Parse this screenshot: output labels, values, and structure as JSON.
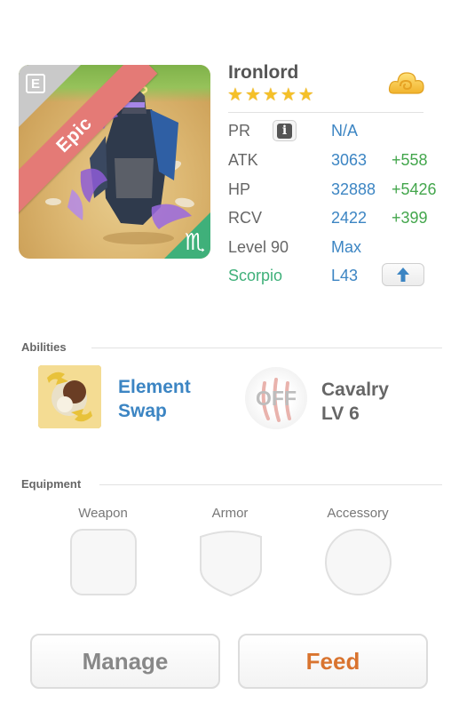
{
  "unit": {
    "name": "Ironlord",
    "rarity": "Epic",
    "star_count": 5,
    "star_glyph": "★"
  },
  "stats": {
    "pr": {
      "label": "PR",
      "value": "N/A"
    },
    "atk": {
      "label": "ATK",
      "value": "3063",
      "bonus": "+558"
    },
    "hp": {
      "label": "HP",
      "value": "32888",
      "bonus": "+5426"
    },
    "rcv": {
      "label": "RCV",
      "value": "2422",
      "bonus": "+399"
    },
    "level": {
      "label": "Level 90",
      "value": "Max"
    },
    "zodiac": {
      "label": "Scorpio",
      "value": "L43",
      "glyph": "♏"
    }
  },
  "abilities": {
    "title": "Abilities",
    "active": {
      "line1": "Element",
      "line2": "Swap"
    },
    "passive": {
      "status": "OFF",
      "line1": "Cavalry",
      "line2": "LV 6"
    }
  },
  "equipment": {
    "title": "Equipment",
    "slots": [
      {
        "label": "Weapon"
      },
      {
        "label": "Armor"
      },
      {
        "label": "Accessory"
      }
    ]
  },
  "actions": {
    "manage": "Manage",
    "feed": "Feed"
  },
  "colors": {
    "rarity_ribbon": "#e47a76",
    "zodiac_green": "#3fb07a",
    "value_blue": "#3c85c3",
    "bonus_green": "#43a64c",
    "feed_orange": "#d9742f",
    "manage_gray": "#888888",
    "star_gold": "#f5c028"
  },
  "icons": {
    "type": "equipment-type-icon",
    "currency": "cloud-icon",
    "info": "info-icon",
    "upgrade": "arrow-up-icon"
  }
}
